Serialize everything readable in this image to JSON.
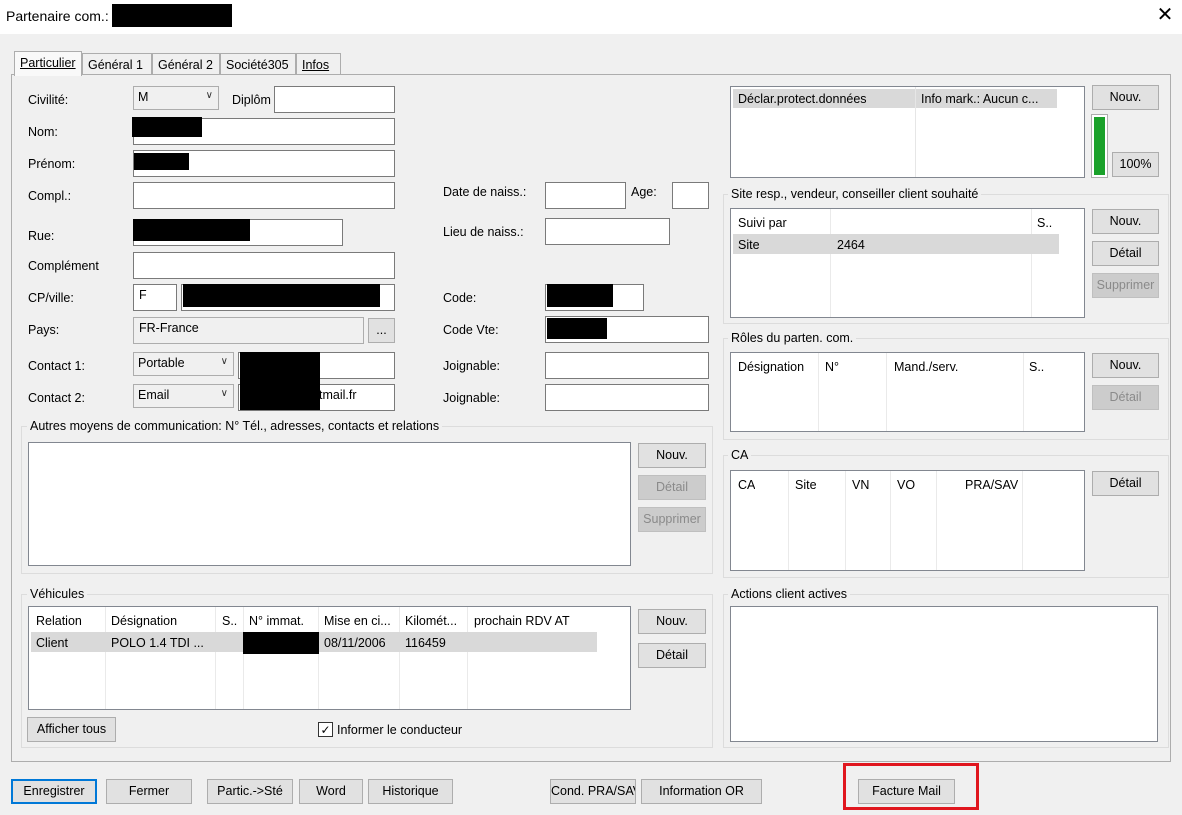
{
  "window": {
    "title": "Partenaire com.:",
    "close_glyph": "✕"
  },
  "tabs": [
    "Particulier",
    "Général 1",
    "Général 2",
    "Société305",
    "Infos"
  ],
  "form": {
    "civilite_label": "Civilité:",
    "civilite_value": "M",
    "diplome_label": "Diplôm",
    "nom_label": "Nom:",
    "prenom_label": "Prénom:",
    "compl_label": "Compl.:",
    "rue_label": "Rue:",
    "complement_label": "Complément",
    "cpville_label": "CP/ville:",
    "cp_value": "F",
    "pays_label": "Pays:",
    "pays_value": "FR-France",
    "pays_button": "...",
    "contact1_label": "Contact 1:",
    "contact1_type": "Portable",
    "contact2_label": "Contact 2:",
    "contact2_type": "Email",
    "contact2_value": "tmail.fr",
    "date_naiss_label": "Date de naiss.:",
    "age_label": "Age:",
    "lieu_naiss_label": "Lieu de naiss.:",
    "code_label": "Code:",
    "code_vte_label": "Code Vte:",
    "joignable1_label": "Joignable:",
    "joignable2_label": "Joignable:"
  },
  "privacy": {
    "columns": [
      "Déclar.protect.données",
      "Info mark.: Aucun c..."
    ],
    "new_button": "Nouv.",
    "percent": "100%",
    "level_color": "#1aa12a"
  },
  "site_resp": {
    "title": "Site resp., vendeur, conseiller client souhaité",
    "columns": [
      "Suivi par",
      "",
      "S.."
    ],
    "row": [
      "Site",
      "2464"
    ],
    "buttons": {
      "new": "Nouv.",
      "detail": "Détail",
      "delete": "Supprimer"
    }
  },
  "roles": {
    "title": "Rôles du parten. com.",
    "columns": [
      "Désignation",
      "N°",
      "Mand./serv.",
      "S.."
    ],
    "buttons": {
      "new": "Nouv.",
      "detail": "Détail"
    }
  },
  "ca": {
    "title": "CA",
    "columns": [
      "CA",
      "Site",
      "VN",
      "VO",
      "PRA/SAV"
    ],
    "detail_button": "Détail"
  },
  "autres": {
    "title": "Autres moyens de communication: N° Tél., adresses, contacts et relations",
    "buttons": {
      "new": "Nouv.",
      "detail": "Détail",
      "delete": "Supprimer"
    }
  },
  "vehicles": {
    "title": "Véhicules",
    "columns": [
      "Relation",
      "Désignation",
      "S..",
      "N° immat.",
      "Mise en ci...",
      "Kilomét...",
      "prochain RDV AT"
    ],
    "row": {
      "relation": "Client",
      "designation": "POLO 1.4 TDI ...",
      "mise": "08/11/2006",
      "km": "116459"
    },
    "buttons": {
      "new": "Nouv.",
      "detail": "Détail",
      "show_all": "Afficher tous"
    },
    "inform_label": "Informer le conducteur",
    "inform_checked": "✓"
  },
  "actions": {
    "title": "Actions client actives"
  },
  "footer": {
    "save": "Enregistrer",
    "close": "Fermer",
    "partic": "Partic.->Sté",
    "word": "Word",
    "history": "Historique",
    "cond": "Cond. PRA/SAV",
    "info_or": "Information OR",
    "invoice_mail": "Facture Mail"
  }
}
